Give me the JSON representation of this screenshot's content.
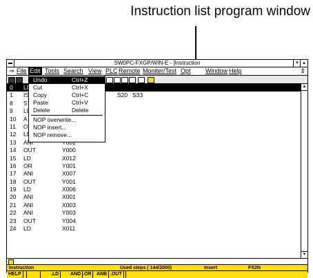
{
  "caption": "Instruction list program window",
  "window": {
    "title": "SW0PC-FXGP/WIN-E - [Instruction"
  },
  "menu": [
    "File",
    "Edit",
    "Tools",
    "Search",
    "View",
    "PLC",
    "Remote",
    "Moniter/Test",
    "Opt",
    "Window",
    "Help"
  ],
  "edit_menu": [
    {
      "label": "Undo",
      "shortcut": "Ctrl+Z"
    },
    {
      "label": "Cut",
      "shortcut": "Ctrl+X"
    },
    {
      "label": "Copy",
      "shortcut": "Ctrl+C"
    },
    {
      "label": "Paste",
      "shortcut": "Ctrl+V"
    },
    {
      "label": "Delete",
      "shortcut": "Delete"
    },
    {
      "label": "NOP overwrite..."
    },
    {
      "label": "NOP insert..."
    },
    {
      "label": "NOP remove..."
    }
  ],
  "instructions": [
    {
      "n": "0",
      "op": "LD",
      "a": "",
      "b": "",
      "c": ""
    },
    {
      "n": "1",
      "op": "IS",
      "a": "",
      "b": "S20",
      "c": "S33"
    },
    {
      "n": "8",
      "op": "ST",
      "a": "",
      "b": "",
      "c": ""
    },
    {
      "n": "9",
      "op": "LD",
      "a": "",
      "b": "",
      "c": ""
    },
    {
      "n": "10",
      "op": "A",
      "a": "",
      "b": "",
      "c": ""
    },
    {
      "n": "11",
      "op": "O",
      "a": "",
      "b": "",
      "c": ""
    },
    {
      "n": "12",
      "op": "LD",
      "a": "X010",
      "b": "",
      "c": ""
    },
    {
      "n": "13",
      "op": "ANI",
      "a": "Y002",
      "b": "",
      "c": ""
    },
    {
      "n": "14",
      "op": "OUT",
      "a": "Y000",
      "b": "",
      "c": ""
    },
    {
      "n": "15",
      "op": "LD",
      "a": "X012",
      "b": "",
      "c": ""
    },
    {
      "n": "16",
      "op": "OR",
      "a": "Y001",
      "b": "",
      "c": ""
    },
    {
      "n": "17",
      "op": "ANI",
      "a": "X007",
      "b": "",
      "c": ""
    },
    {
      "n": "18",
      "op": "OUT",
      "a": "Y001",
      "b": "",
      "c": ""
    },
    {
      "n": "19",
      "op": "LD",
      "a": "X006",
      "b": "",
      "c": ""
    },
    {
      "n": "20",
      "op": "ANI",
      "a": "X001",
      "b": "",
      "c": ""
    },
    {
      "n": "21",
      "op": "ANI",
      "a": "X003",
      "b": "",
      "c": ""
    },
    {
      "n": "22",
      "op": "ANI",
      "a": "Y003",
      "b": "",
      "c": ""
    },
    {
      "n": "23",
      "op": "OUT",
      "a": "Y004",
      "b": "",
      "c": ""
    },
    {
      "n": "24",
      "op": "LD",
      "a": "X011",
      "b": "",
      "c": ""
    }
  ],
  "status": {
    "mode": "Instruction",
    "steps": "Used steps ( 144/2000)",
    "insert": "Insert",
    "plc": "FX2N"
  },
  "fkeys": [
    "HELP",
    "",
    "",
    ".LD",
    "AND",
    ".OR",
    "ANB",
    ".OUT",
    ""
  ],
  "colors": {
    "statusbar": "#ffe000"
  }
}
